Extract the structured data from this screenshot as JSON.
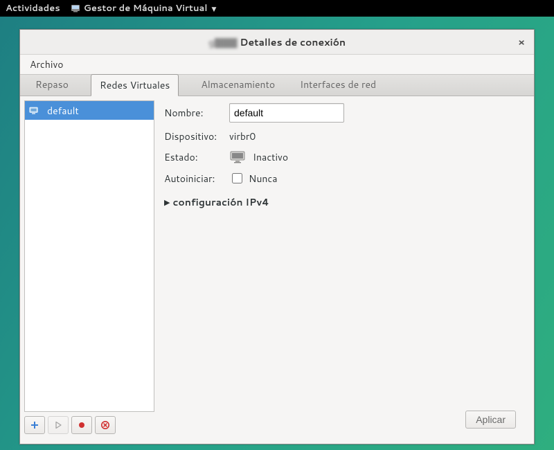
{
  "topbar": {
    "activities": "Actividades",
    "app_name": "Gestor de Máquina Virtual"
  },
  "window": {
    "title_obscured": "g▇▇▇",
    "title": "Detalles de conexión",
    "close_icon": "×",
    "menu": {
      "file": "Archivo"
    },
    "tabs": {
      "overview": "Repaso",
      "vnets": "Redes Virtuales",
      "storage": "Almacenamiento",
      "ifaces": "Interfaces de red"
    },
    "networks": {
      "items": [
        {
          "name": "default"
        }
      ]
    },
    "toolbar": {
      "add": "add-network",
      "play": "start-network",
      "stop": "stop-network",
      "delete": "delete-network"
    },
    "form": {
      "name_label": "Nombre:",
      "name_value": "default",
      "device_label": "Dispositivo:",
      "device_value": "virbr0",
      "state_label": "Estado:",
      "state_value": "Inactivo",
      "autostart_label": "Autoiniciar:",
      "autostart_checked": false,
      "autostart_text": "Nunca",
      "ipv4_expander": "configuración IPv4"
    },
    "apply": "Aplicar"
  }
}
